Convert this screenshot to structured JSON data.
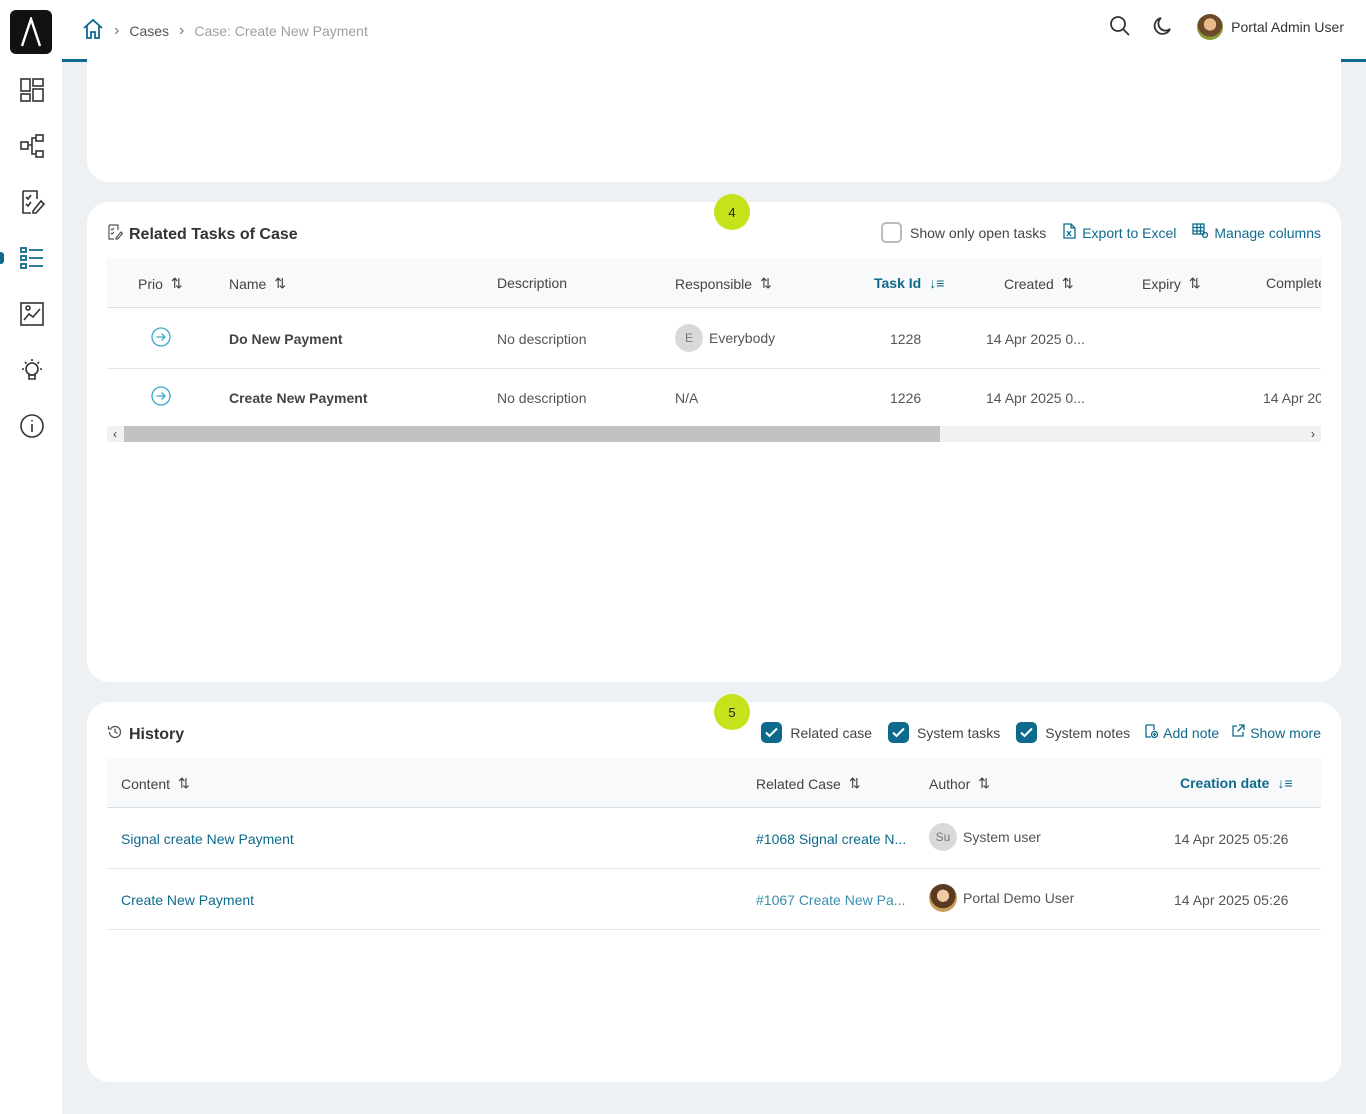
{
  "header": {
    "breadcrumb": [
      "Cases",
      "Case: Create New Payment"
    ],
    "user_name": "Portal Admin User"
  },
  "sidebar": {
    "items": [
      {
        "icon": "dashboard-icon"
      },
      {
        "icon": "process-icon"
      },
      {
        "icon": "tasks-icon"
      },
      {
        "icon": "cases-list-icon",
        "active": true
      },
      {
        "icon": "statistics-icon"
      },
      {
        "icon": "lightbulb-icon"
      },
      {
        "icon": "info-icon"
      }
    ]
  },
  "tasks": {
    "step": "4",
    "title": "Related Tasks of Case",
    "show_open_label": "Show only open tasks",
    "export_label": "Export to Excel",
    "manage_label": "Manage columns",
    "columns": [
      "Prio",
      "Name",
      "Description",
      "Responsible",
      "Task Id",
      "Created",
      "Expiry",
      "Complete"
    ],
    "rows": [
      {
        "name": "Do New Payment",
        "description": "No description",
        "responsible_initial": "E",
        "responsible": "Everybody",
        "task_id": "1228",
        "created": "14 Apr 2025 0...",
        "expiry": "",
        "completed": ""
      },
      {
        "name": "Create New Payment",
        "description": "No description",
        "responsible_initial": "",
        "responsible": "N/A",
        "task_id": "1226",
        "created": "14 Apr 2025 0...",
        "expiry": "",
        "completed": "14 Apr 20"
      }
    ]
  },
  "history": {
    "step": "5",
    "title": "History",
    "filters": [
      "Related case",
      "System tasks",
      "System notes"
    ],
    "add_note_label": "Add note",
    "show_more_label": "Show more",
    "columns": [
      "Content",
      "Related Case",
      "Author",
      "Creation date"
    ],
    "rows": [
      {
        "content": "Signal create New Payment",
        "related_case": "#1068 Signal create N...",
        "author_initial": "Su",
        "author": "System user",
        "date": "14 Apr 2025 05:26"
      },
      {
        "content": "Create New Payment",
        "related_case": "#1067 Create New Pa...",
        "author_initial": "",
        "author": "Portal Demo User",
        "date": "14 Apr 2025 05:26"
      }
    ]
  },
  "colors": {
    "accent": "#0e6a8c",
    "badge": "#c5e21b"
  }
}
